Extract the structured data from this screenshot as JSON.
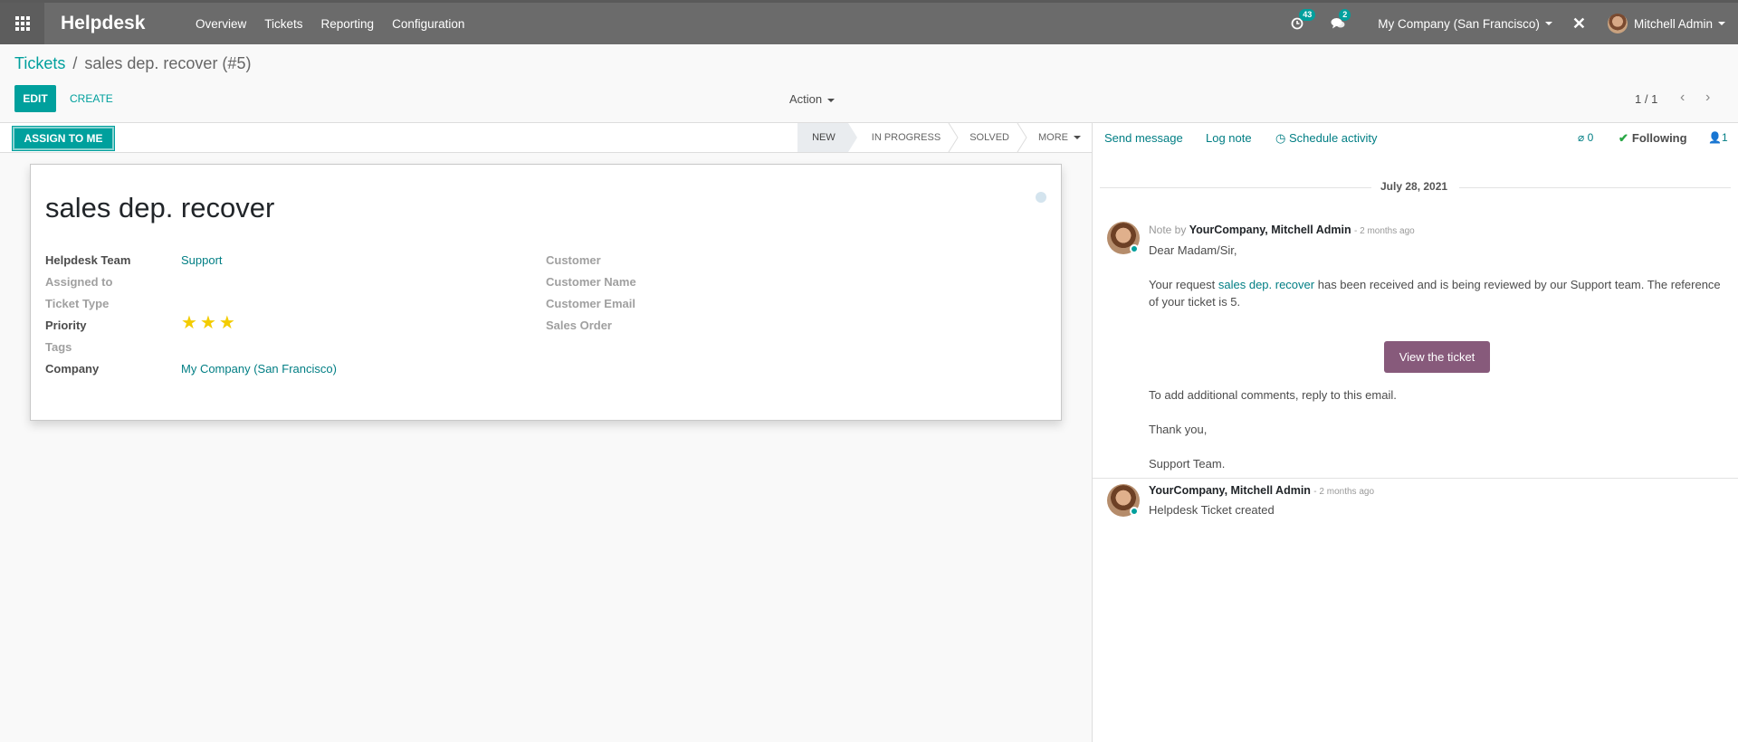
{
  "nav": {
    "brand": "Helpdesk",
    "menu": [
      "Overview",
      "Tickets",
      "Reporting",
      "Configuration"
    ],
    "activity_count": "43",
    "message_count": "2",
    "company": "My Company (San Francisco)",
    "user": "Mitchell Admin"
  },
  "breadcrumb": {
    "parent": "Tickets",
    "separator": "/",
    "current": "sales dep. recover (#5)"
  },
  "toolbar": {
    "edit": "EDIT",
    "create": "CREATE",
    "action": "Action",
    "pager": "1 / 1",
    "prev": "‹",
    "next": "›"
  },
  "statusbar": {
    "assign": "ASSIGN TO ME",
    "stages": [
      "NEW",
      "IN PROGRESS",
      "SOLVED",
      "MORE"
    ]
  },
  "form": {
    "title": "sales dep. recover",
    "left_fields": [
      {
        "label": "Helpdesk Team",
        "value": "Support"
      },
      {
        "label": "Assigned to",
        "value": ""
      },
      {
        "label": "Ticket Type",
        "value": ""
      },
      {
        "label": "Priority",
        "value": "3"
      },
      {
        "label": "Tags",
        "value": ""
      },
      {
        "label": "Company",
        "value": "My Company (San Francisco)"
      }
    ],
    "right_fields": [
      {
        "label": "Customer",
        "value": ""
      },
      {
        "label": "Customer Name",
        "value": ""
      },
      {
        "label": "Customer Email",
        "value": ""
      },
      {
        "label": "Sales Order",
        "value": ""
      }
    ],
    "priority_stars": 3
  },
  "chatter": {
    "send_message": "Send message",
    "log_note": "Log note",
    "schedule_activity": "Schedule activity",
    "attachments": "0",
    "following": "Following",
    "followers": "1",
    "date": "July 28, 2021",
    "messages": [
      {
        "prefix": "Note by",
        "author": "YourCompany, Mitchell Admin",
        "when": "- 2 months ago",
        "greeting": "Dear Madam/Sir,",
        "body_pre": "Your request",
        "body_link": "sales dep. recover",
        "body_post": "has been received and is being reviewed by our Support team. The reference",
        "body_line2": "of your ticket is 5.",
        "button": "View the ticket",
        "line_add": "To add additional comments, reply to this email.",
        "thanks": "Thank you,",
        "signature": "Support Team."
      },
      {
        "author": "YourCompany, Mitchell Admin",
        "when": "- 2 months ago",
        "body": "Helpdesk Ticket created"
      }
    ]
  },
  "colors": {
    "primary": "#00a09d",
    "link": "#017e84",
    "odoo_purple": "#875a7b",
    "star": "#f3cc00"
  }
}
